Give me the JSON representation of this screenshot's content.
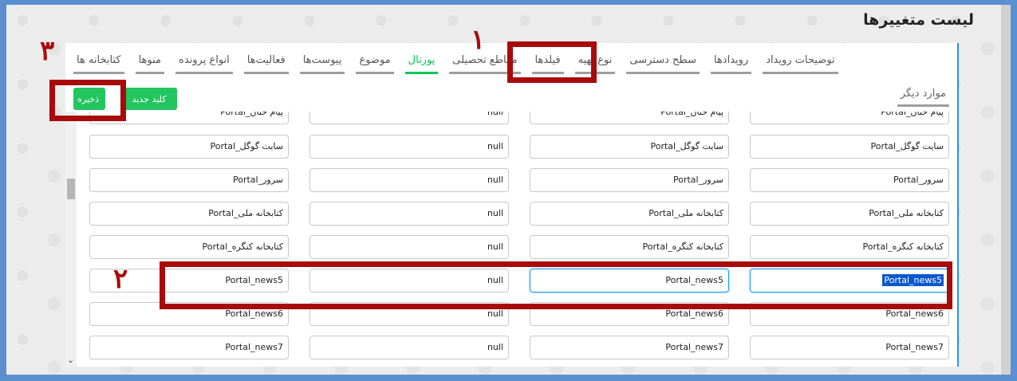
{
  "page_title": "لیست متغییرها",
  "tabs": [
    "کتابخانه ها",
    "منوها",
    "انواع پرونده",
    "فعالیت‌ها",
    "پیوست‌ها",
    "موضوع",
    "پورتال",
    "مقاطع تحصیلی",
    "فیلدها",
    "نوع تهیه",
    "سطح دسترسی",
    "رویدادها",
    "توضیحات رویداد"
  ],
  "other_tab": "موارد دیگر",
  "buttons": {
    "save": "ذخیره",
    "new_key": "کلید جدید"
  },
  "rows": [
    [
      "Portal_پیام حنان",
      "Portal_پیام حنان",
      "null",
      "Portal_پیام حنان"
    ],
    [
      "Portal_سایت گوگل",
      "Portal_سایت گوگل",
      "null",
      "Portal_سایت گوگل"
    ],
    [
      "Portal_سرور",
      "Portal_سرور",
      "null",
      "Portal_سرور"
    ],
    [
      "Portal_کتابخانه ملی",
      "Portal_کتابخانه ملی",
      "null",
      "Portal_کتابخانه ملی"
    ],
    [
      "Portal_کتابخانه کنگره",
      "Portal_کتابخانه کنگره",
      "null",
      "Portal_کتابخانه کنگره"
    ],
    [
      "Portal_news5",
      "Portal_news5",
      "null",
      "Portal_news5"
    ],
    [
      "Portal_news6",
      "Portal_news6",
      "null",
      "Portal_news6"
    ],
    [
      "Portal_news7",
      "Portal_news7",
      "null",
      "Portal_news7"
    ]
  ],
  "annotations": [
    "۱",
    "۲",
    "۳"
  ],
  "colors": {
    "accent": "#22c55e",
    "annotation": "#a80b0b",
    "focus": "#2196f3",
    "frame": "#5b8fcf"
  }
}
